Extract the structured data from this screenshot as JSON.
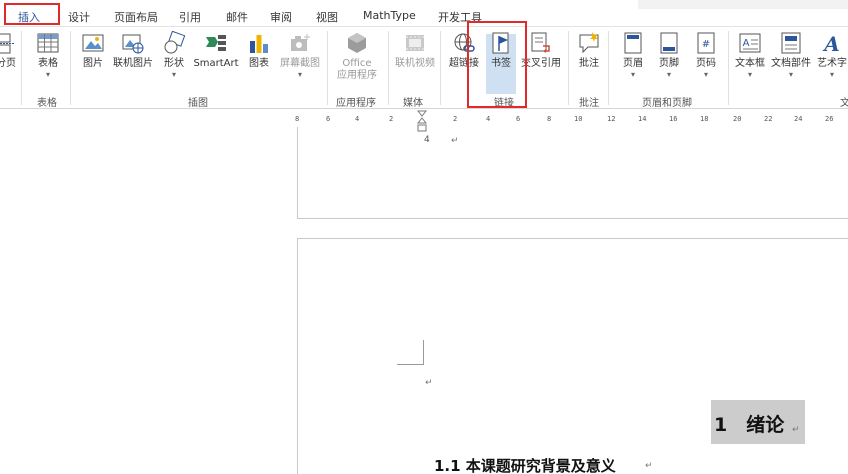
{
  "tabs": [
    {
      "label": "插入",
      "active": true
    },
    {
      "label": "设计"
    },
    {
      "label": "页面布局"
    },
    {
      "label": "引用"
    },
    {
      "label": "邮件"
    },
    {
      "label": "审阅"
    },
    {
      "label": "视图"
    },
    {
      "label": "MathType"
    },
    {
      "label": "开发工具"
    }
  ],
  "ribbon": {
    "buttons": {
      "page_break": "分页",
      "table": "表格",
      "picture": "图片",
      "online_picture": "联机图片",
      "shapes": "形状",
      "smartart": "SmartArt",
      "chart": "图表",
      "screenshot": "屏幕截图",
      "office_apps_1": "Office",
      "office_apps_2": "应用程序",
      "online_video": "联机视频",
      "hyperlink": "超链接",
      "bookmark": "书签",
      "cross_reference": "交叉引用",
      "comment": "批注",
      "header": "页眉",
      "footer": "页脚",
      "page_number": "页码",
      "textbox": "文本框",
      "quick_parts": "文档部件",
      "wordart": "艺术字"
    },
    "groups": {
      "tables": "表格",
      "illustrations": "插图",
      "apps": "应用程序",
      "media": "媒体",
      "links": "链接",
      "comments": "批注",
      "header_footer": "页眉和页脚",
      "text_partial": "文"
    }
  },
  "ruler": {
    "ticks": [
      "8",
      "6",
      "4",
      "2",
      "2",
      "4",
      "6",
      "8",
      "10",
      "12",
      "14",
      "16",
      "18",
      "20",
      "22",
      "24",
      "26"
    ]
  },
  "document": {
    "page_number_mark": "4",
    "paragraph_mark": "↵",
    "heading1": "1　绪论",
    "heading2": "1.1 本课题研究背景及意义"
  },
  "colors": {
    "accent": "#2b579a",
    "highlight_red": "#e12b2b",
    "bookmark_selected": "#cfe0f3"
  }
}
